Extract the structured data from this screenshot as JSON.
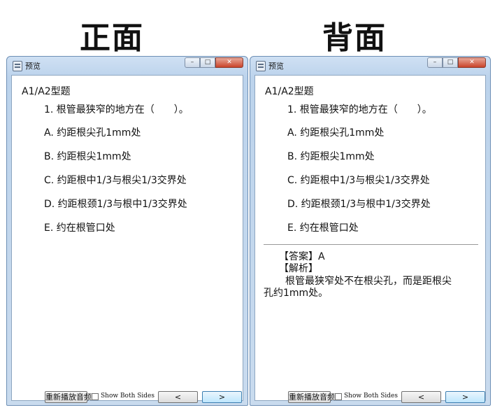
{
  "headings": {
    "front": "正面",
    "back": "背面"
  },
  "window_title": "预览",
  "question": {
    "type": "A1/A2型题",
    "stem": "1. 根管最狭窄的地方在（　　）。",
    "options": [
      "A.  约距根尖孔1mm处",
      "B.  约距根尖1mm处",
      "C.  约距根中1/3与根尖1/3交界处",
      "D.  约距根颈1/3与根中1/3交界处",
      "E.  约在根管口处"
    ]
  },
  "answer": {
    "answer_line": "【答案】A",
    "analysis_label": "【解析】",
    "analysis_text_1": "根管最狭窄处不在根尖孔，而是距根尖",
    "analysis_text_2": "孔约1mm处。"
  },
  "controls": {
    "replay_label": "重新播放音频",
    "show_both_sides_label": "Show Both Sides",
    "show_both_sides_checked": false,
    "prev_label": "<",
    "next_label": ">"
  },
  "window_buttons": {
    "minimize": "–",
    "maximize": "□",
    "close": "✕"
  }
}
